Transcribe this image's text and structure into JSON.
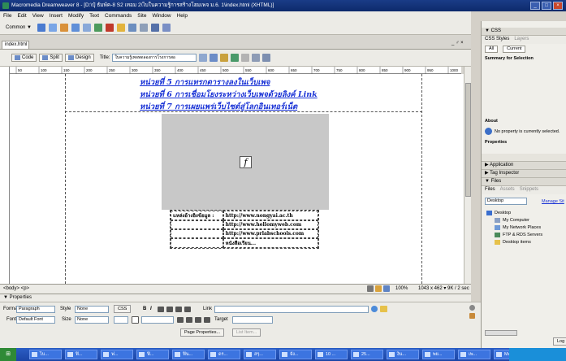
{
  "window": {
    "title": "Macromedia Dreamweaver 8 - [D:\\ปุ๋ ธัมพัค-8 S2 เทอม 2\\ไบในความรู้การสร้างโฮมเพจ ม.6. 1\\index.html (XHTML)]"
  },
  "menubar": {
    "items": [
      "File",
      "Edit",
      "View",
      "Insert",
      "Modify",
      "Text",
      "Commands",
      "Site",
      "Window",
      "Help"
    ]
  },
  "insertbar": {
    "category": "Common ▼"
  },
  "document": {
    "tab": "index.html",
    "window_controls": "_ ♂ ×",
    "views": {
      "code": "Code",
      "split": "Split",
      "design": "Design"
    },
    "title_label": "Title:",
    "title_value": "ใบความรู้เพจทดลองการโรงการสอ",
    "ruler_marks": [
      "50",
      "100",
      "150",
      "200",
      "250",
      "300",
      "350",
      "400",
      "450",
      "500",
      "550",
      "600",
      "650",
      "700",
      "750",
      "800",
      "850",
      "900",
      "950",
      "1000"
    ],
    "links": [
      "หน่วยที่ 5 การแทรกตารางลงในเว็บเพจ",
      "หน่วยที่ 6 การเชื่อมโยงระหว่างเว็บเพจด้วยลิงค์ Link",
      "หน่วยที่ 7 การเผยแพร่เว็บไซต์สู่โลกอินเทอร์เน็ต"
    ],
    "flash_glyph": "f",
    "contact_rows": [
      [
        "แหล่งอ้างอิงข้อมูล :",
        "http://www.nongyai.ac.th"
      ],
      [
        "",
        "http://www.hellomyweb.com"
      ],
      [
        "",
        "http://www.prlabschools.com"
      ],
      [
        "",
        "หนังสือเรียน..."
      ]
    ]
  },
  "statusbar": {
    "tag": "<body> <p>",
    "zoom": "100%",
    "size": "1043 x 462 ▾  9K / 2 sec"
  },
  "properties": {
    "header": "▼ Properties",
    "format_label": "Format",
    "format_value": "Paragraph",
    "style_label": "Style",
    "style_value": "None",
    "css_button": "CSS",
    "link_label": "Link",
    "font_label": "Font",
    "font_value": "Default Font",
    "size_label": "Size",
    "size_value": "None",
    "target_label": "Target",
    "page_properties": "Page Properties...",
    "list_item": "List Item..."
  },
  "right_panel": {
    "css_header": "▼ CSS",
    "css_tabs": [
      "CSS Styles",
      "Layers"
    ],
    "css_subtabs": [
      "All",
      "Current"
    ],
    "summary": "Summary for Selection",
    "about": "About",
    "no_property": "No property is currently selected.",
    "properties": "Properties",
    "application": "▶ Application",
    "tag_inspector": "▶ Tag Inspector",
    "files_header": "▼ Files",
    "files_tabs": [
      "Files",
      "Assets",
      "Snippets"
    ],
    "site_select": "Desktop",
    "manage_sites": "Manage Sit",
    "tree": [
      "Desktop",
      "My Computer",
      "My Network Places",
      "FTP & RDS Servers",
      "Desktop items"
    ],
    "log_button": "Log"
  },
  "taskbar": {
    "items": [
      "ไบ...",
      "ฟิ...",
      "ฟ...",
      "ฟิ...",
      "ฟิน...",
      "ดร...",
      "สรุ...",
      "จัง...",
      "10 ...",
      "25...",
      "งิน...",
      "พย...",
      "เพ...",
      "Ma..."
    ]
  }
}
